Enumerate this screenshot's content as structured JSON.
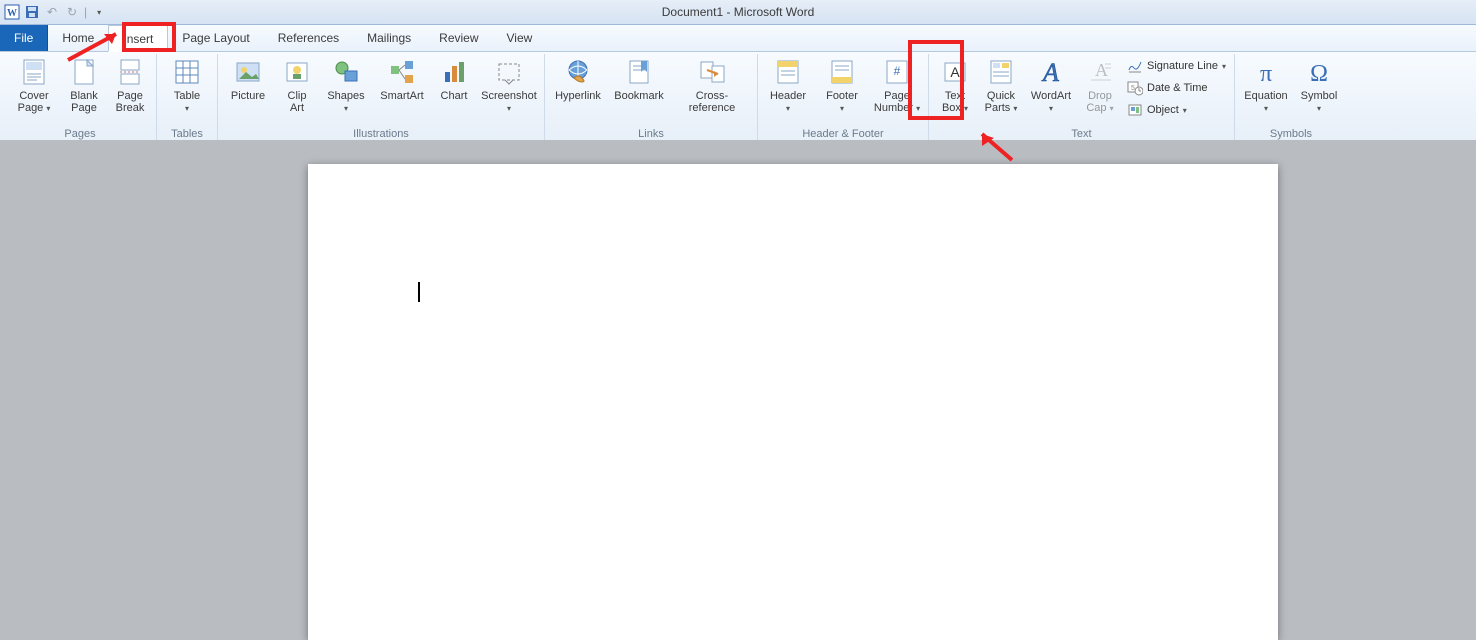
{
  "title": "Document1 - Microsoft Word",
  "tabs": {
    "file": "File",
    "home": "Home",
    "insert": "Insert",
    "pagelayout": "Page Layout",
    "references": "References",
    "mailings": "Mailings",
    "review": "Review",
    "view": "View"
  },
  "groups": {
    "pages": {
      "label": "Pages",
      "cover": "Cover\nPage",
      "blank": "Blank\nPage",
      "pagebreak": "Page\nBreak"
    },
    "tables": {
      "label": "Tables",
      "table": "Table"
    },
    "illustrations": {
      "label": "Illustrations",
      "picture": "Picture",
      "clipart": "Clip\nArt",
      "shapes": "Shapes",
      "smartart": "SmartArt",
      "chart": "Chart",
      "screenshot": "Screenshot"
    },
    "links": {
      "label": "Links",
      "hyperlink": "Hyperlink",
      "bookmark": "Bookmark",
      "crossref": "Cross-reference"
    },
    "hf": {
      "label": "Header & Footer",
      "header": "Header",
      "footer": "Footer",
      "pagenum": "Page\nNumber"
    },
    "text": {
      "label": "Text",
      "textbox": "Text\nBox",
      "quickparts": "Quick\nParts",
      "wordart": "WordArt",
      "dropcap": "Drop\nCap",
      "sigline": "Signature Line",
      "datetime": "Date & Time",
      "object": "Object"
    },
    "symbols": {
      "label": "Symbols",
      "equation": "Equation",
      "symbol": "Symbol"
    }
  }
}
